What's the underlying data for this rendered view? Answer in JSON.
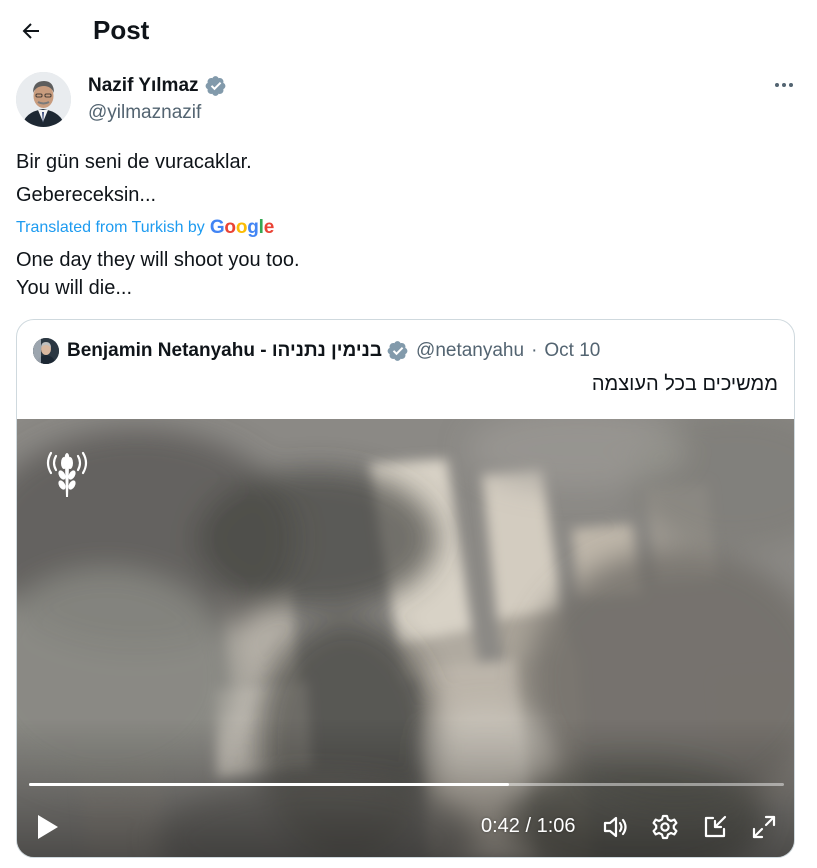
{
  "header": {
    "title": "Post",
    "back_icon": "arrow-left-icon"
  },
  "post": {
    "author_name": "Nazif Yılmaz",
    "author_handle": "@yilmaznazif",
    "verified": true,
    "text_line1": "Bir gün seni de vuracaklar.",
    "text_line2": "Gebereceksin...",
    "translated_from": "Translated from Turkish by",
    "translator": "Google",
    "translation_line1": "One day they will shoot you too.",
    "translation_line2": "You will die..."
  },
  "quote": {
    "author_name": "Benjamin Netanyahu - בנימין נתניהו",
    "author_handle": "@netanyahu",
    "separator": "·",
    "date": "Oct 10",
    "text": "ממשיכים בכל העוצמה"
  },
  "video": {
    "current_time": "0:42",
    "time_separator": "/",
    "duration": "1:06",
    "progress_fraction": 0.636
  },
  "colors": {
    "text_primary": "#0f1419",
    "text_secondary": "#536471",
    "link_blue": "#1d9bf0",
    "verified_blue": "#1d9bf0",
    "border": "#cfd9de"
  }
}
